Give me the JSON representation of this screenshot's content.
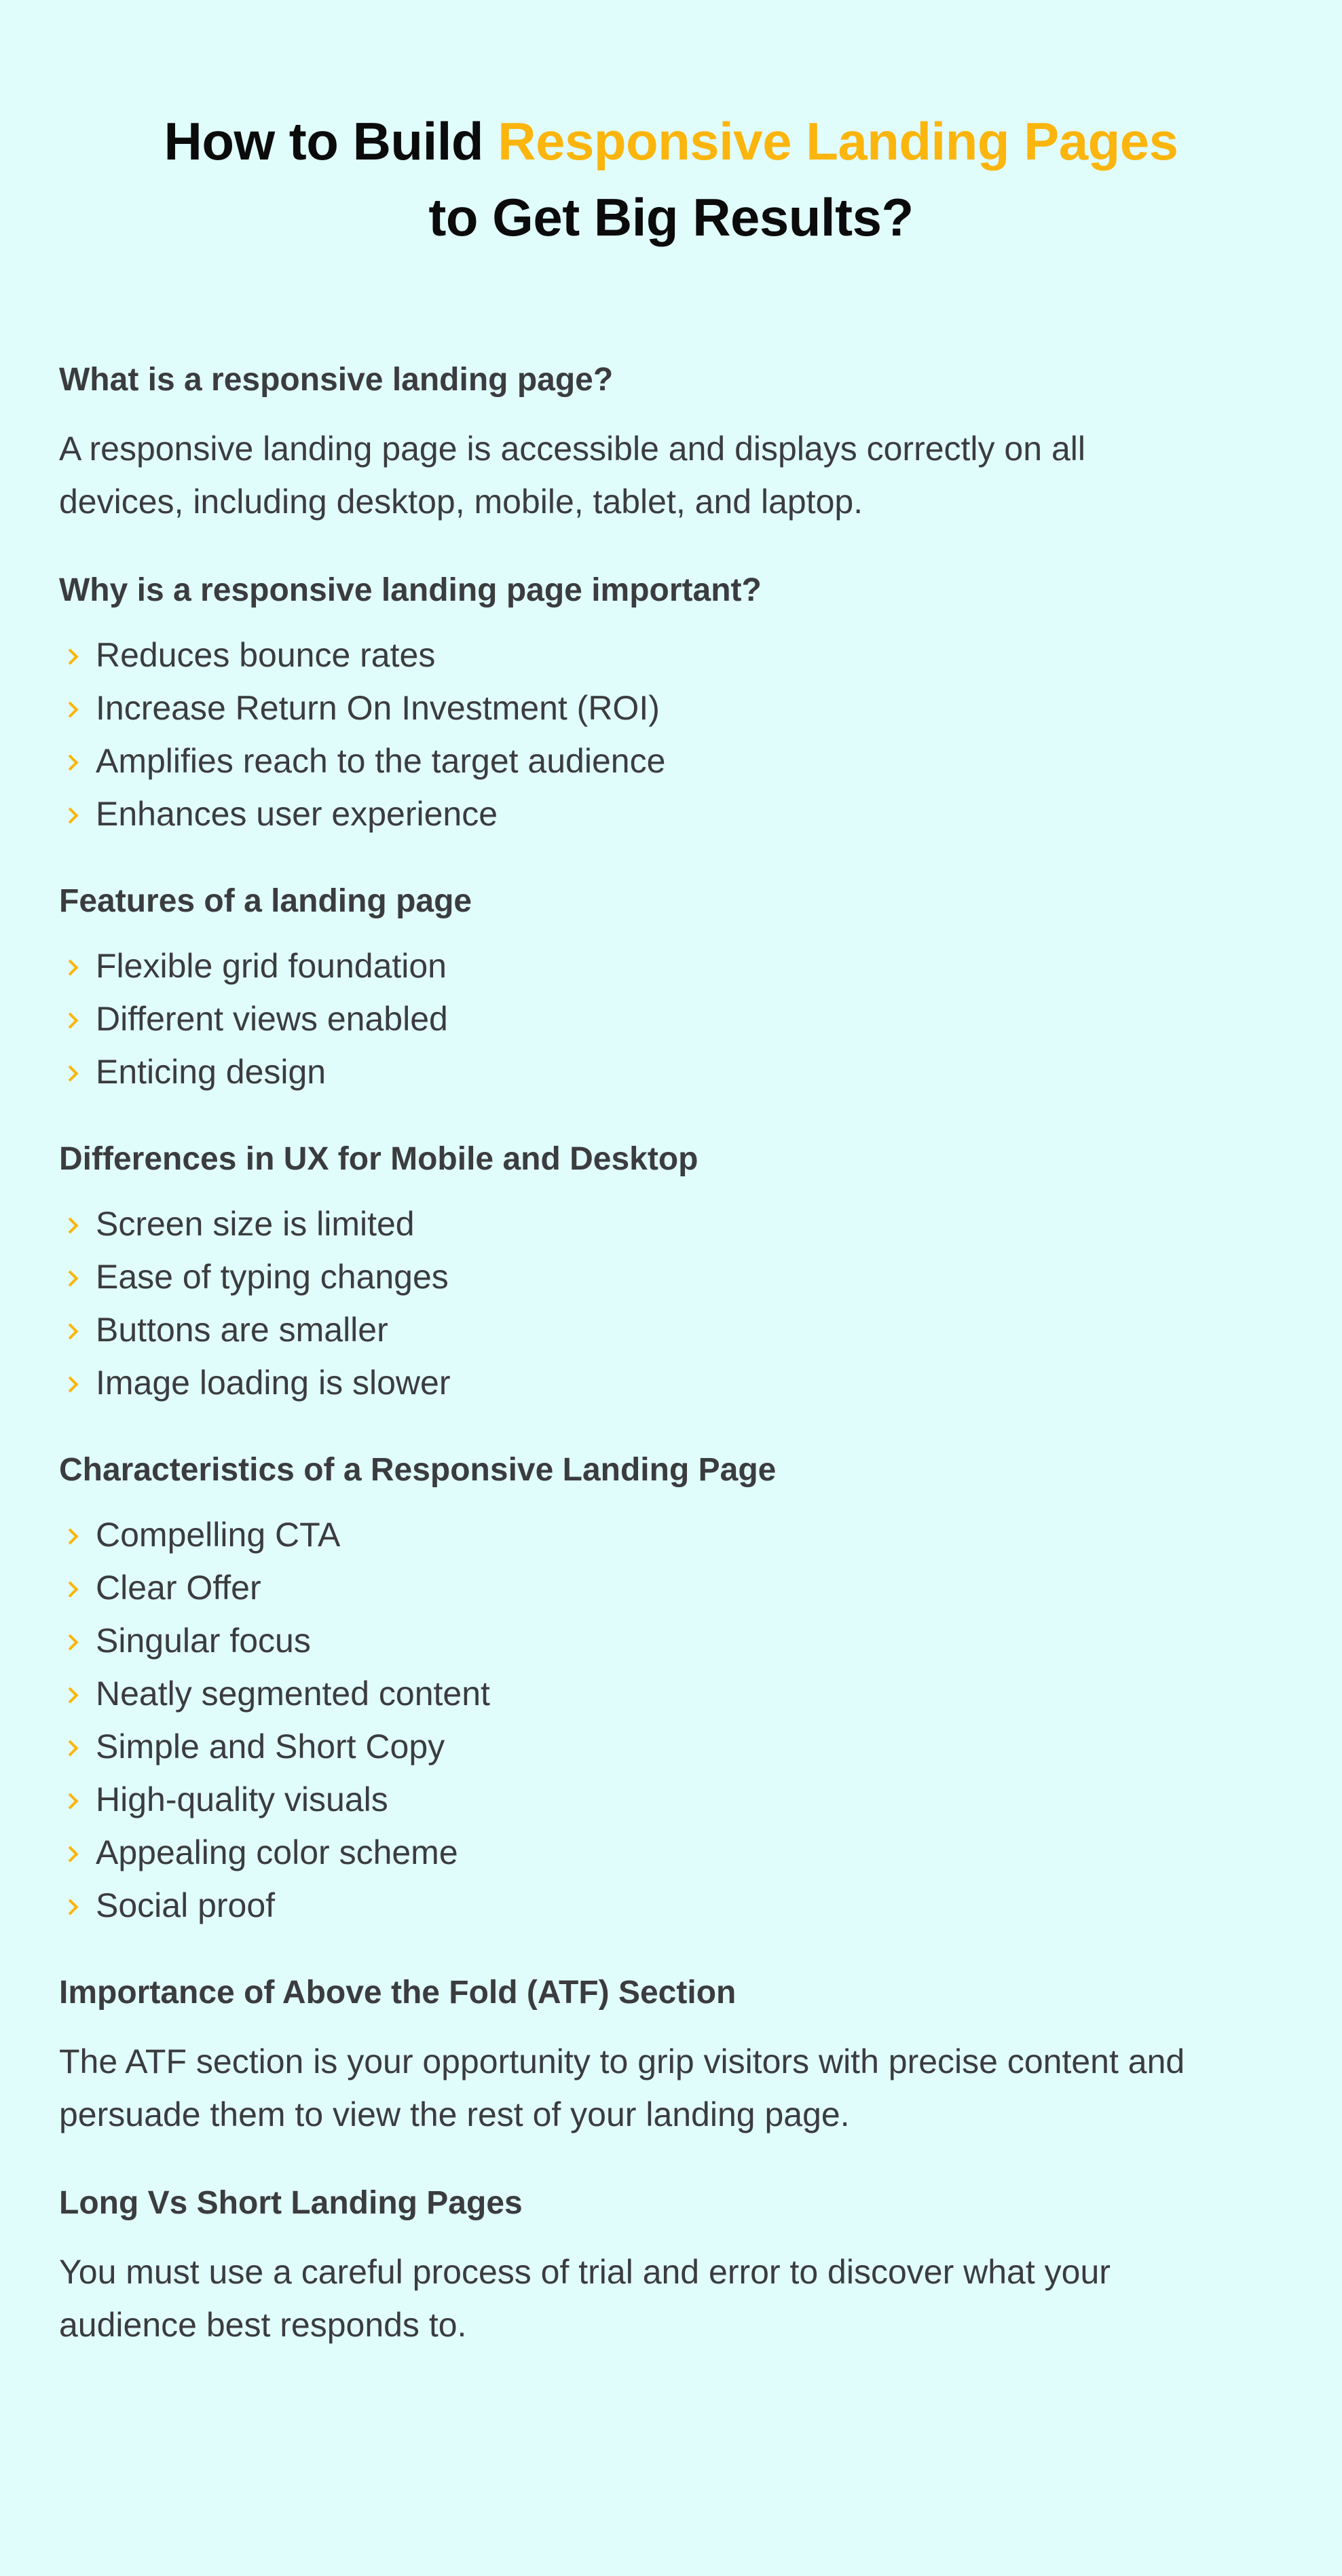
{
  "title": {
    "line1_prefix": "How to Build ",
    "line1_accent": "Responsive Landing Pages",
    "line2": "to Get Big Results?"
  },
  "colors": {
    "background": "#e0fcfb",
    "accent": "#fcb50c",
    "title_text": "#0b0b0b",
    "body_text": "#3b3c3e"
  },
  "sections": [
    {
      "heading": "What is a responsive landing page?",
      "paragraph_lines": [
        "A responsive landing page is accessible and displays correctly on all",
        "devices, including desktop, mobile, tablet, and laptop."
      ]
    },
    {
      "heading": "Why is a responsive landing page important?",
      "bullets": [
        "Reduces bounce rates",
        "Increase Return On Investment (ROI)",
        "Amplifies reach to the target audience",
        "Enhances user experience"
      ]
    },
    {
      "heading": "Features of a landing page",
      "bullets": [
        "Flexible grid foundation",
        "Different views enabled",
        "Enticing design"
      ]
    },
    {
      "heading": "Differences in UX for Mobile and Desktop",
      "bullets": [
        "Screen size is limited",
        "Ease of typing changes",
        "Buttons are smaller",
        "Image loading is slower"
      ]
    },
    {
      "heading": "Characteristics of a Responsive Landing Page",
      "bullets": [
        "Compelling CTA",
        "Clear Offer",
        "Singular focus",
        "Neatly segmented content",
        "Simple and Short Copy",
        "High-quality visuals",
        "Appealing color scheme",
        "Social proof"
      ]
    },
    {
      "heading": "Importance of Above the Fold (ATF) Section",
      "paragraph_lines": [
        "The ATF section is your opportunity to grip visitors with precise content and",
        "persuade them to view the rest of your landing page."
      ]
    },
    {
      "heading": "Long Vs Short Landing Pages",
      "paragraph_lines": [
        "You must use a careful process of trial and error to discover what your",
        "audience best responds to."
      ]
    }
  ],
  "icons": {
    "bullet": "chevron-right-icon"
  }
}
